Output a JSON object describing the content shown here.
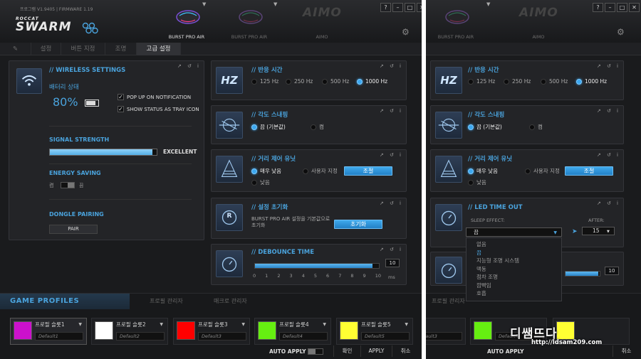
{
  "app": {
    "version": "프로그램 V1.9405 | FIRMWARE 1.19",
    "brand_top": "ROCCAT",
    "brand_main": "SWARM"
  },
  "devices": [
    {
      "name": "BURST PRO AIR"
    },
    {
      "name": "BURST PRO AIR"
    },
    {
      "name": "AIMO"
    }
  ],
  "aimo_logo": "AIMO",
  "window_controls": {
    "help": "?",
    "min": "–",
    "max": "□",
    "close": "✕"
  },
  "tabs": [
    "설정",
    "버튼 지정",
    "조명",
    "고급 설정"
  ],
  "pin_glyph": "✎",
  "wireless": {
    "title": "WIRELESS SETTINGS",
    "battery_label": "배터리 상태",
    "battery_value": "80%",
    "battery_level": 0.8,
    "popup_label": "POP UP ON NOTIFICATION",
    "tray_label": "SHOW STATUS AS TRAY ICON",
    "check": "✓",
    "signal_header": "SIGNAL STRENGTH",
    "signal_value": "EXCELLENT",
    "signal_level": 0.96,
    "energy_header": "ENERGY SAVING",
    "energy_off": "켬",
    "energy_on": "끔",
    "dongle_header": "DONGLE PAIRING",
    "pair_label": "PAIR"
  },
  "panel_ctl": "↗ ↺ i",
  "polling": {
    "title": "반응 시간",
    "icon_text": "HZ",
    "options": [
      "125 Hz",
      "250 Hz",
      "500 Hz",
      "1000 Hz"
    ],
    "selected": "1000 Hz"
  },
  "angle": {
    "title": "각도 스내핑",
    "options": [
      "끔 (기본값)",
      "켬"
    ],
    "selected": "끔 (기본값)"
  },
  "lift": {
    "title": "거리 제어 유닛",
    "options": [
      "매우 낮음",
      "사용자 지정",
      "낮음"
    ],
    "selected": "매우 낮음",
    "button": "조절"
  },
  "reset": {
    "title": "설정 초기화",
    "icon_text": "R",
    "desc1": "BURST PRO AIR 설정을 기본값으로",
    "desc2": "초기화",
    "button": "초기화"
  },
  "debounce": {
    "title": "DEBOUNCE TIME",
    "value": "10",
    "level": 0.95,
    "ticks": [
      "0",
      "1",
      "2",
      "3",
      "4",
      "5",
      "6",
      "7",
      "8",
      "9",
      "10"
    ],
    "unit": "ms"
  },
  "led": {
    "title": "LED TIME OUT",
    "sleep_label": "SLEEP EFFECT:",
    "after_label": "AFTER:",
    "selected": "끔",
    "after_value": "15",
    "options": [
      "없음",
      "끔",
      "지능형 조명 시스템",
      "맥동",
      "점차 조명",
      "깜빡임",
      "호흡"
    ]
  },
  "profiles": {
    "tab_active": "GAME PROFILES",
    "tab2": "프로필 관리자",
    "tab3": "매크로 관리자",
    "slots": [
      {
        "name": "프로필 슬롯1",
        "default": "Default1",
        "color": "#cc11cc"
      },
      {
        "name": "프로필 슬롯2",
        "default": "Default2",
        "color": "#ffffff"
      },
      {
        "name": "프로필 슬롯3",
        "default": "Default3",
        "color": "#ff0000"
      },
      {
        "name": "프로필 슬롯4",
        "default": "Default4",
        "color": "#66ee11"
      },
      {
        "name": "프로필 슬롯5",
        "default": "Default5",
        "color": "#ffff33"
      }
    ],
    "auto_apply": "AUTO APPLY",
    "ok": "확인",
    "apply": "APPLY",
    "cancel": "취소"
  },
  "right": {
    "tab2": "프로필 관리자",
    "slot_default": "Default3",
    "slot_default2": "Default4",
    "auto_apply": "AUTO APPLY",
    "cancel": "취소"
  },
  "watermark": "http://ldsam209.com",
  "watermark_brand": "디쌤뜨다",
  "colors": {
    "accent": "#4aa3dd",
    "bg": "#1a1b1d",
    "panel": "#232427"
  }
}
